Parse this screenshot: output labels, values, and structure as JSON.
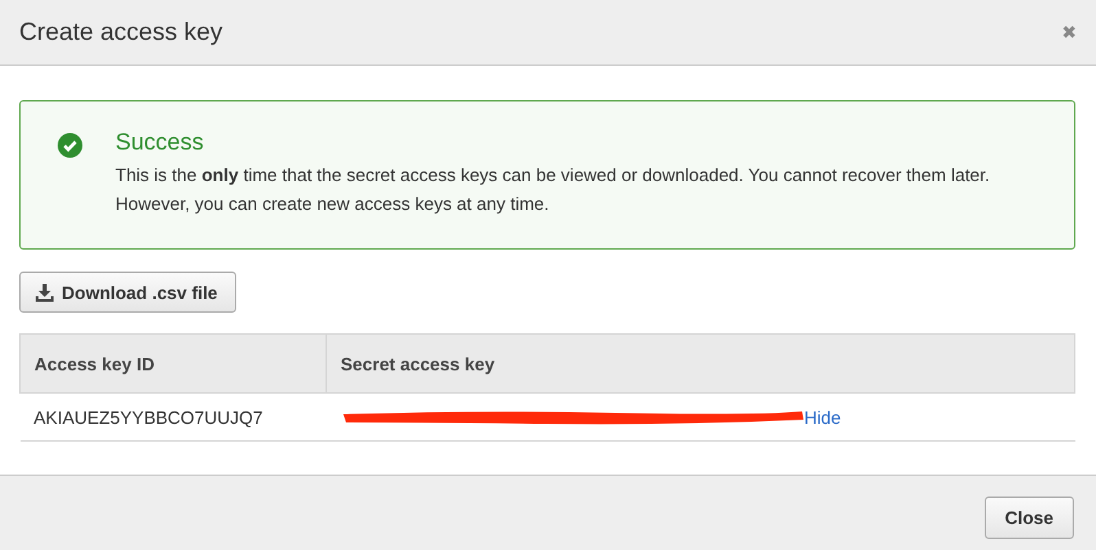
{
  "dialog": {
    "title": "Create access key",
    "close_glyph": "✖"
  },
  "alert": {
    "kind": "success",
    "title": "Success",
    "message": "This is the **only** time that the secret access keys can be viewed or downloaded. You cannot recover them later. However, you can create new access keys at any time."
  },
  "download_button": {
    "label": "Download .csv file"
  },
  "table": {
    "columns": [
      "Access key ID",
      "Secret access key"
    ],
    "rows": [
      {
        "access_key_id": "AKIAUEZ5YYBBCO7UUJQ7",
        "secret_redacted": true,
        "toggle_link": "Hide"
      }
    ]
  },
  "footer": {
    "buttons": [
      "Close"
    ]
  }
}
